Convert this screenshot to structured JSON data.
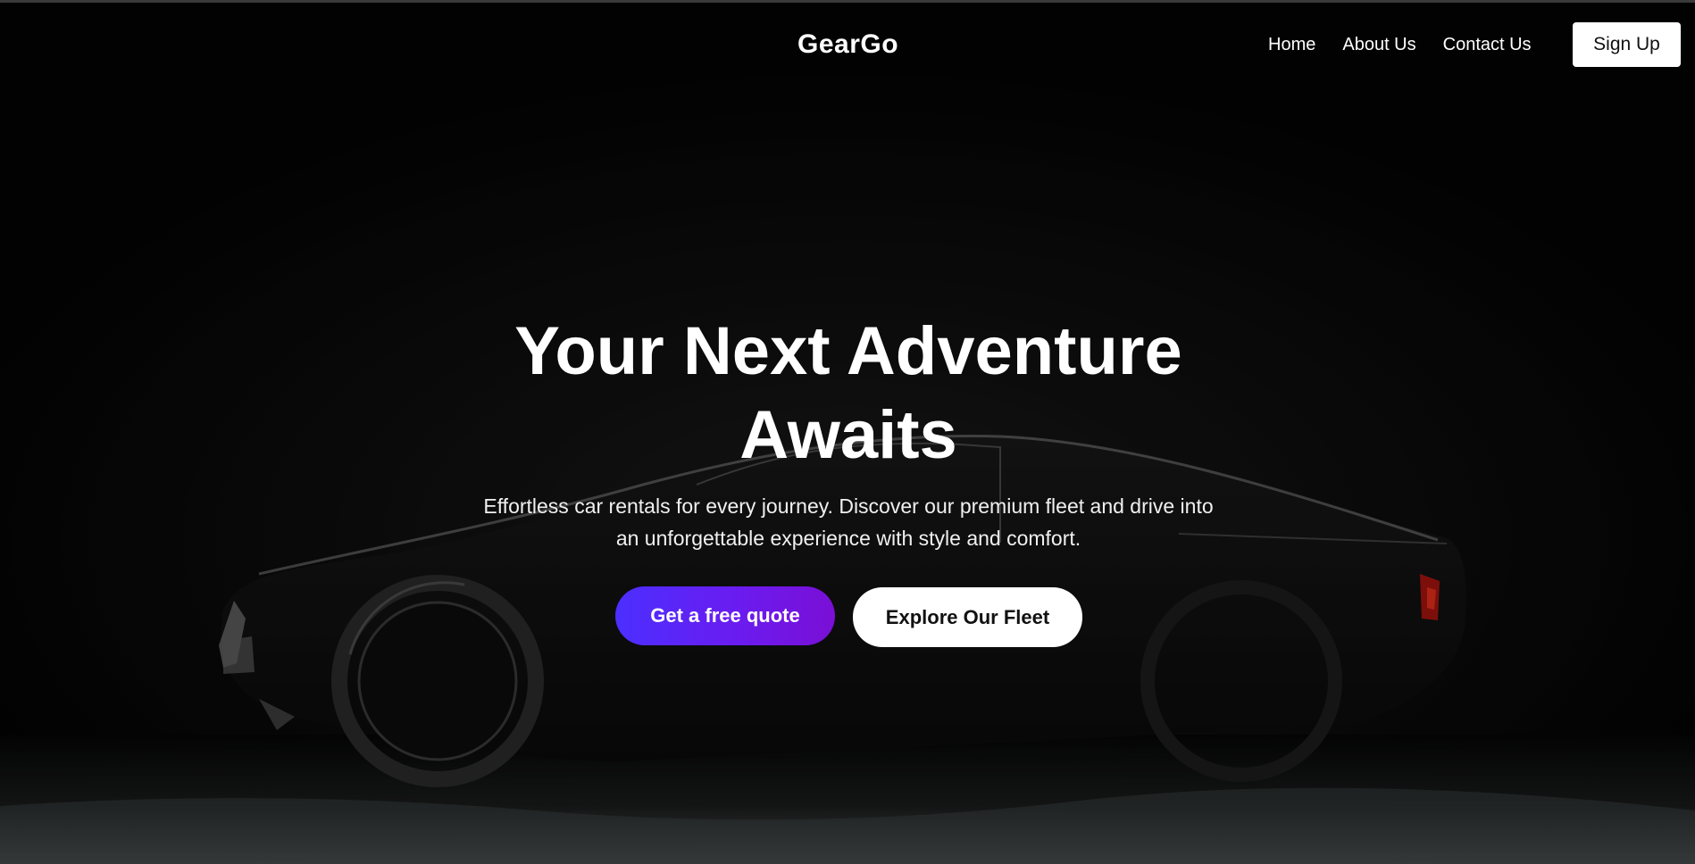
{
  "header": {
    "brand": "GearGo",
    "nav": [
      "Home",
      "About Us",
      "Contact Us"
    ],
    "signup_label": "Sign Up"
  },
  "hero": {
    "title_line1": "Your Next Adventure",
    "title_line2": "Awaits",
    "subtitle_line1": "Effortless car rentals for every journey. Discover our premium fleet and drive into",
    "subtitle_line2": "an unforgettable experience with style and comfort.",
    "primary_cta": "Get a free quote",
    "secondary_cta": "Explore Our Fleet",
    "background_image": "dark-sports-car-silhouette"
  },
  "colors": {
    "background": "#030303",
    "cta_gradient_start": "#4b2fff",
    "cta_gradient_end": "#7a0fd6",
    "taillight": "#c2160f"
  }
}
